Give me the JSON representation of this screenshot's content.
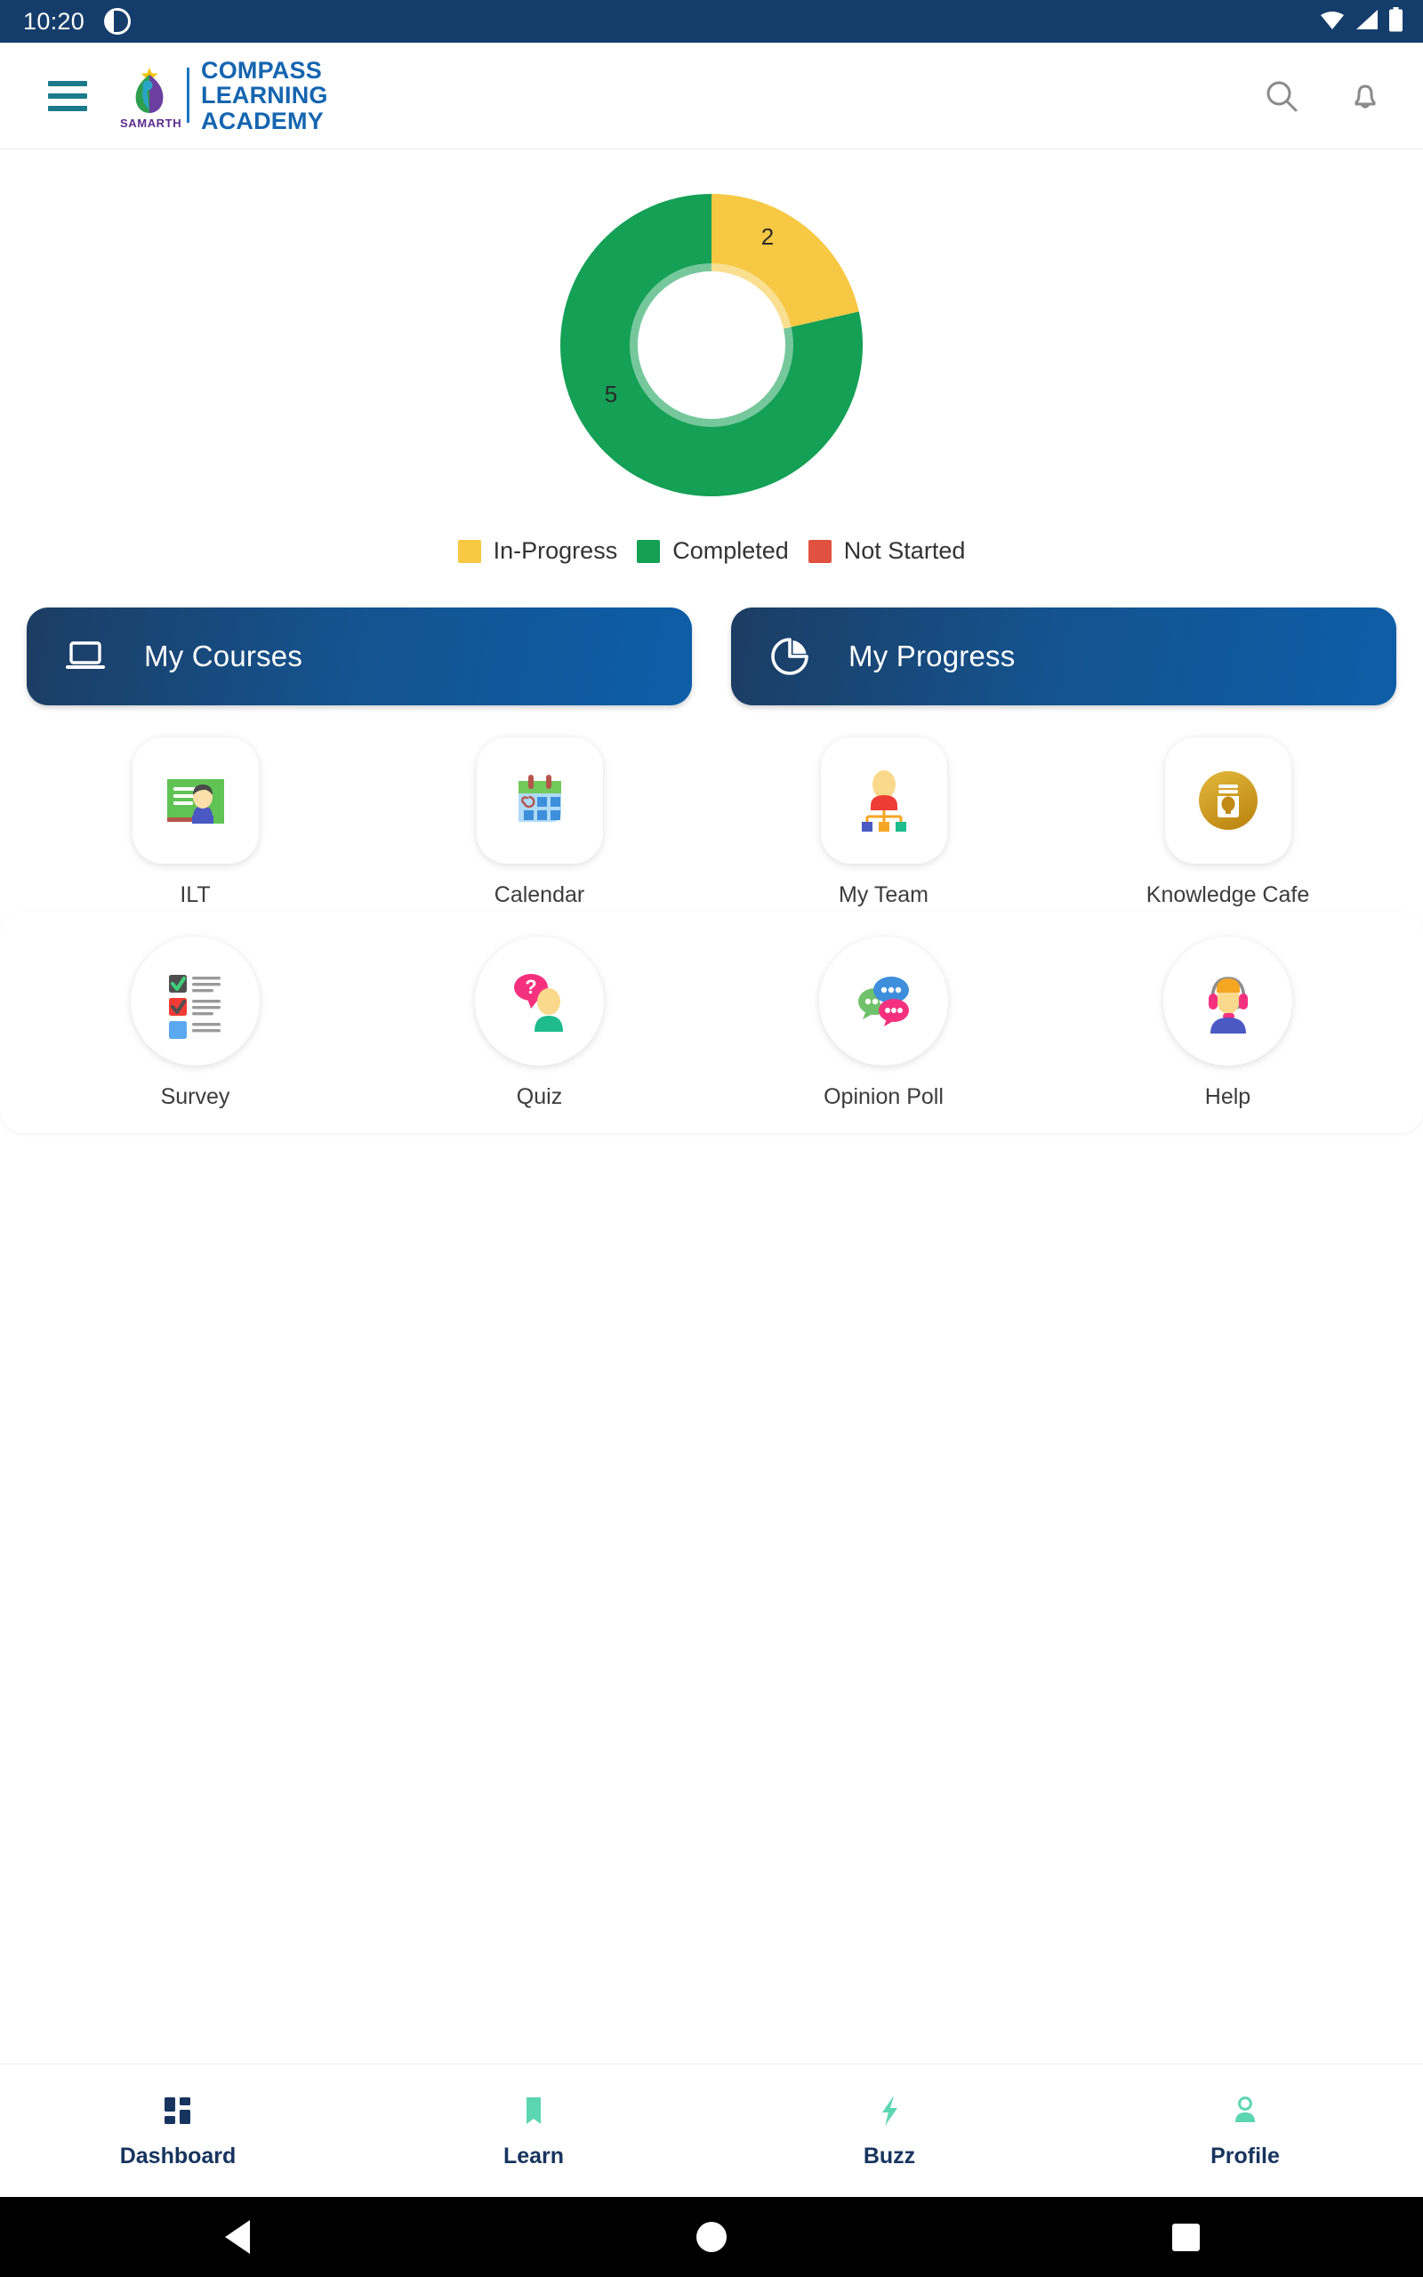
{
  "status_bar": {
    "time": "10:20",
    "app_icon": "notification-circle-icon",
    "wifi_icon": "wifi-icon",
    "signal_icon": "cellular-signal-icon",
    "battery_icon": "battery-icon"
  },
  "header": {
    "menu_icon": "hamburger-menu-icon",
    "logo_mark_text": "SAMARTH",
    "brand_line1": "COMPASS",
    "brand_line2": "LEARNING",
    "brand_line3": "ACADEMY",
    "search_icon": "search-icon",
    "notification_icon": "bell-icon"
  },
  "chart_data": {
    "type": "pie",
    "title": "",
    "categories": [
      "In-Progress",
      "Completed",
      "Not Started"
    ],
    "values": [
      2,
      5,
      0
    ],
    "colors": [
      "#F7C843",
      "#14A055",
      "#E0523F"
    ],
    "data_labels": [
      "2",
      "5"
    ],
    "donut": true,
    "inner_radius_ratio": 0.52,
    "start_angle": 0,
    "legend_position": "bottom",
    "legend": [
      {
        "label": "In-Progress",
        "color": "#F7C843"
      },
      {
        "label": "Completed",
        "color": "#14A055"
      },
      {
        "label": "Not Started",
        "color": "#E0523F"
      }
    ]
  },
  "primary_actions": [
    {
      "label": "My Courses",
      "icon": "laptop-icon"
    },
    {
      "label": "My Progress",
      "icon": "pie-chart-icon"
    }
  ],
  "app_grid": {
    "row1": [
      {
        "label": "ILT",
        "icon": "classroom-board-icon"
      },
      {
        "label": "Calendar",
        "icon": "calendar-icon"
      },
      {
        "label": "My Team",
        "icon": "org-chart-icon"
      },
      {
        "label": "Knowledge Cafe",
        "icon": "coffee-lightbulb-icon"
      }
    ],
    "row2": [
      {
        "label": "Survey",
        "icon": "checklist-icon"
      },
      {
        "label": "Quiz",
        "icon": "question-person-icon"
      },
      {
        "label": "Opinion Poll",
        "icon": "speech-bubbles-icon"
      },
      {
        "label": "Help",
        "icon": "headset-support-icon"
      }
    ]
  },
  "bottom_nav": {
    "items": [
      {
        "label": "Dashboard",
        "icon": "grid-dashboard-icon",
        "active": true,
        "color": "#16345E"
      },
      {
        "label": "Learn",
        "icon": "book-icon",
        "active": false,
        "color": "#5BD6B0"
      },
      {
        "label": "Buzz",
        "icon": "lightning-bolt-icon",
        "active": false,
        "color": "#5BD6B0"
      },
      {
        "label": "Profile",
        "icon": "person-icon",
        "active": false,
        "color": "#5BD6B0"
      }
    ]
  },
  "system_nav": {
    "back": "back-triangle-icon",
    "home": "home-circle-icon",
    "recents": "recents-square-icon"
  },
  "theme": {
    "status_bar_bg": "#153D6B",
    "brand_blue": "#1565B0",
    "accent_teal": "#1B7B8C",
    "nav_active": "#16345E",
    "nav_inactive": "#5BD6B0"
  }
}
